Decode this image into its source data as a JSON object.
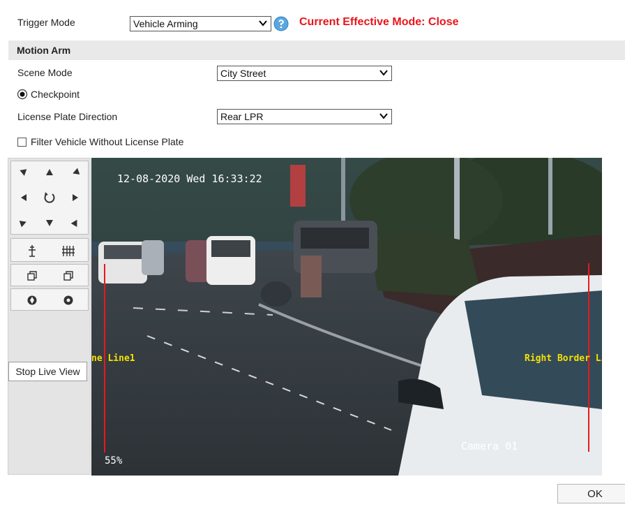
{
  "trigger": {
    "label": "Trigger Mode",
    "value": "Vehicle Arming",
    "current_mode": "Current Effective Mode:  Close"
  },
  "section": {
    "title": "Motion Arm"
  },
  "scene": {
    "label": "Scene Mode",
    "value": "City Street"
  },
  "checkpoint": {
    "label": "Checkpoint"
  },
  "plate_direction": {
    "label": "License Plate Direction",
    "value": "Rear LPR"
  },
  "filter": {
    "label": "Filter Vehicle Without License Plate"
  },
  "ptz": {
    "stop_label": "Stop Live View"
  },
  "video": {
    "timestamp": "12-08-2020 Wed 16:33:22",
    "left_line_label": "ne Line1",
    "right_line_label": "Right Border Lin",
    "camera_label": "Camera 01",
    "zoom_level": "55%"
  },
  "footer": {
    "ok_label": "OK"
  },
  "colors": {
    "accent_red": "#e8151b",
    "line_red": "#e41b1b",
    "line_label_yellow": "#f5e100"
  }
}
